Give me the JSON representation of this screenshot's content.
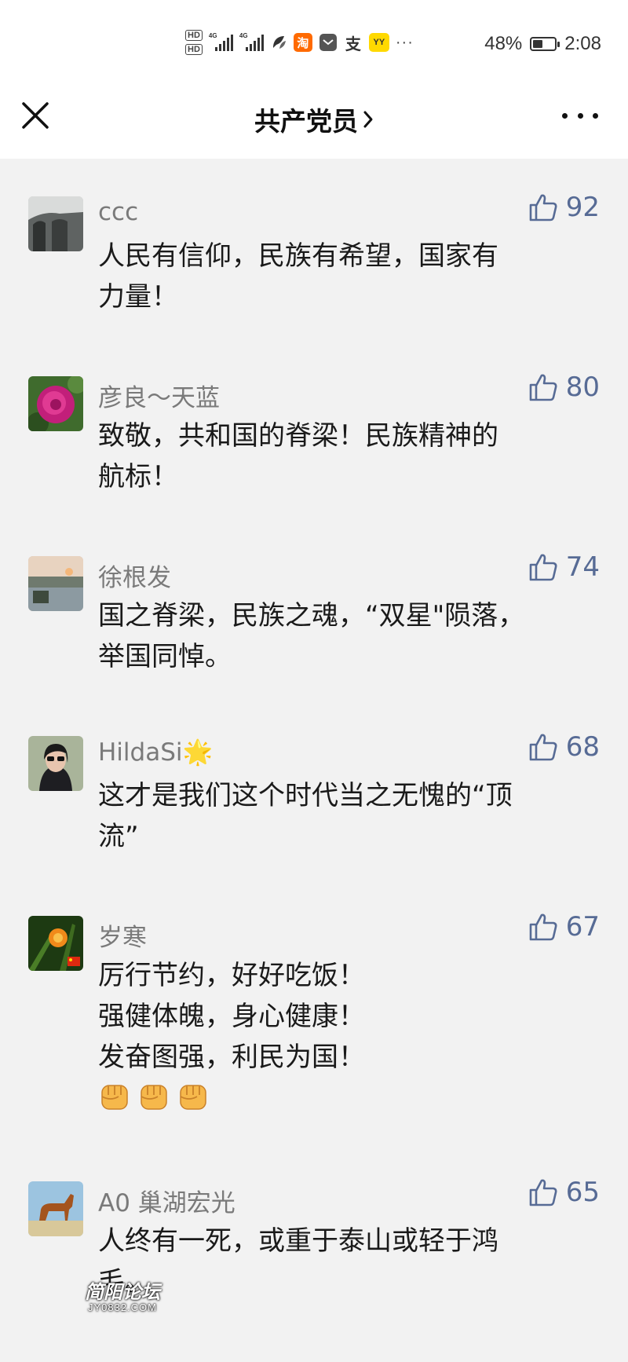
{
  "status_bar": {
    "hd_top": "HD",
    "hd_bottom": "HD",
    "net1": "4G",
    "net2": "4G",
    "app_taobao": "淘",
    "app_alipay": "支",
    "app_yy": "YY",
    "more": "···",
    "battery_percent": "48%",
    "battery_level": 0.48,
    "time": "2:08"
  },
  "header": {
    "title": "共产党员",
    "close_icon": "close-icon",
    "menu_icon": "more-dots-icon"
  },
  "colors": {
    "like_blue": "#576b95",
    "nickname_gray": "#7a7a7a",
    "background": "#f2f2f2"
  },
  "comments": [
    {
      "nickname": "ccc",
      "likes": "92",
      "lines": [
        "人民有信仰，民族有希望，国家有",
        "力量！"
      ]
    },
    {
      "nickname": "彦良～天蓝",
      "likes": "80",
      "lines": [
        "致敬，共和国的脊梁！民族精神的",
        "航标！"
      ]
    },
    {
      "nickname": "徐根发",
      "likes": "74",
      "lines": [
        "国之脊梁，民族之魂，“双星\"陨落，",
        "举国同悼。"
      ]
    },
    {
      "nickname": "HildaSi",
      "nickname_emoji": "🌟",
      "likes": "68",
      "lines": [
        "这才是我们这个时代当之无愧的“顶",
        "流”"
      ]
    },
    {
      "nickname": "岁寒",
      "likes": "67",
      "lines": [
        "厉行节约，好好吃饭！",
        "强健体魄，身心健康！",
        "发奋图强，利民为国！"
      ],
      "emoji_count": 3
    },
    {
      "nickname": "A0 巢湖宏光",
      "likes": "65",
      "lines": [
        "人终有一死，或重于泰山或轻于鸿",
        "毛。"
      ]
    }
  ],
  "watermark": {
    "line1": "简阳论坛",
    "line2": "JY0832.COM"
  }
}
